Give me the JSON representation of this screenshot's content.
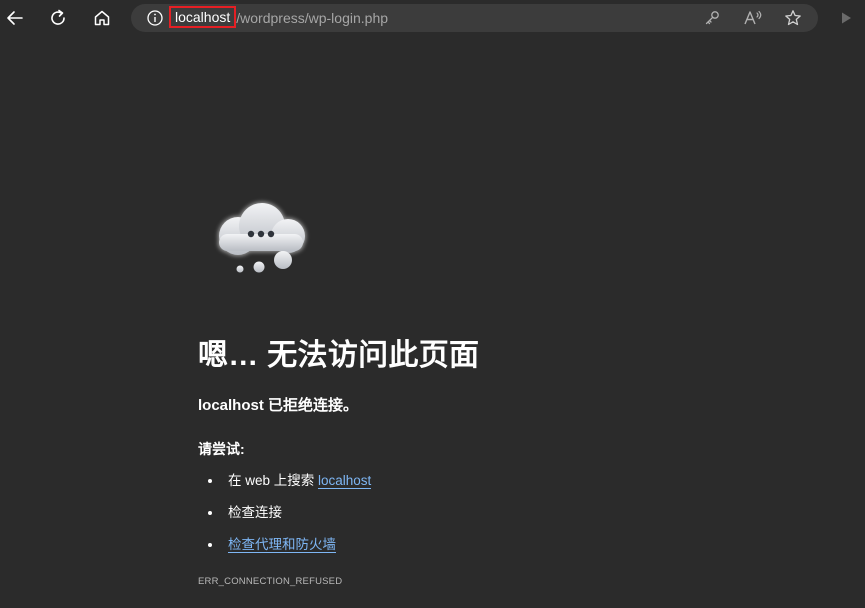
{
  "browser": {
    "url": {
      "host": "localhost",
      "path": "/wordpress/wp-login.php"
    }
  },
  "error_page": {
    "title": "嗯… 无法访问此页面",
    "subtitle_host": "localhost",
    "subtitle_rest": " 已拒绝连接。",
    "try_label": "请尝试:",
    "suggestions": {
      "search_prefix": "在 web 上搜索 ",
      "search_link": "localhost",
      "check_connection": "检查连接",
      "check_proxy": "检查代理和防火墙"
    },
    "error_code": "ERR_CONNECTION_REFUSED"
  },
  "icons": {
    "back": "back-arrow-icon",
    "refresh": "refresh-icon",
    "home": "home-icon",
    "info": "info-icon",
    "key": "key-icon",
    "read_aloud": "read-aloud-icon",
    "favorite": "star-icon",
    "play": "play-icon",
    "cloud": "cloud-error-icon"
  },
  "colors": {
    "background": "#2b2b2b",
    "address_bar": "#3c3c3c",
    "link": "#7eb6f4",
    "highlight_box": "#e51f24"
  }
}
